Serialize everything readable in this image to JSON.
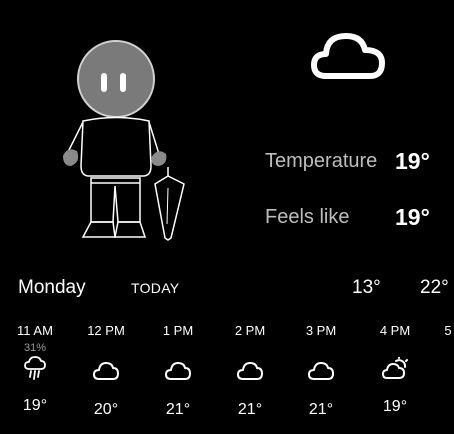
{
  "current": {
    "condition_icon": "cloud-icon",
    "temperature": {
      "label": "Temperature",
      "value": "19°"
    },
    "feels_like": {
      "label": "Feels like",
      "value": "19°"
    }
  },
  "day": {
    "name": "Monday",
    "tag": "TODAY",
    "low": "13°",
    "high": "22°"
  },
  "hourly": [
    {
      "time": "11 AM",
      "precip": "31%",
      "icon": "rain-cloud-icon",
      "temp": "19°"
    },
    {
      "time": "12 PM",
      "precip": "",
      "icon": "cloud-icon",
      "temp": "20°"
    },
    {
      "time": "1 PM",
      "precip": "",
      "icon": "cloud-icon",
      "temp": "21°"
    },
    {
      "time": "2 PM",
      "precip": "",
      "icon": "cloud-icon",
      "temp": "21°"
    },
    {
      "time": "3 PM",
      "precip": "",
      "icon": "cloud-icon",
      "temp": "21°"
    },
    {
      "time": "4 PM",
      "precip": "",
      "icon": "partly-cloudy-icon",
      "temp": "19°"
    },
    {
      "time": "5",
      "precip": "",
      "icon": "",
      "temp": ""
    }
  ]
}
